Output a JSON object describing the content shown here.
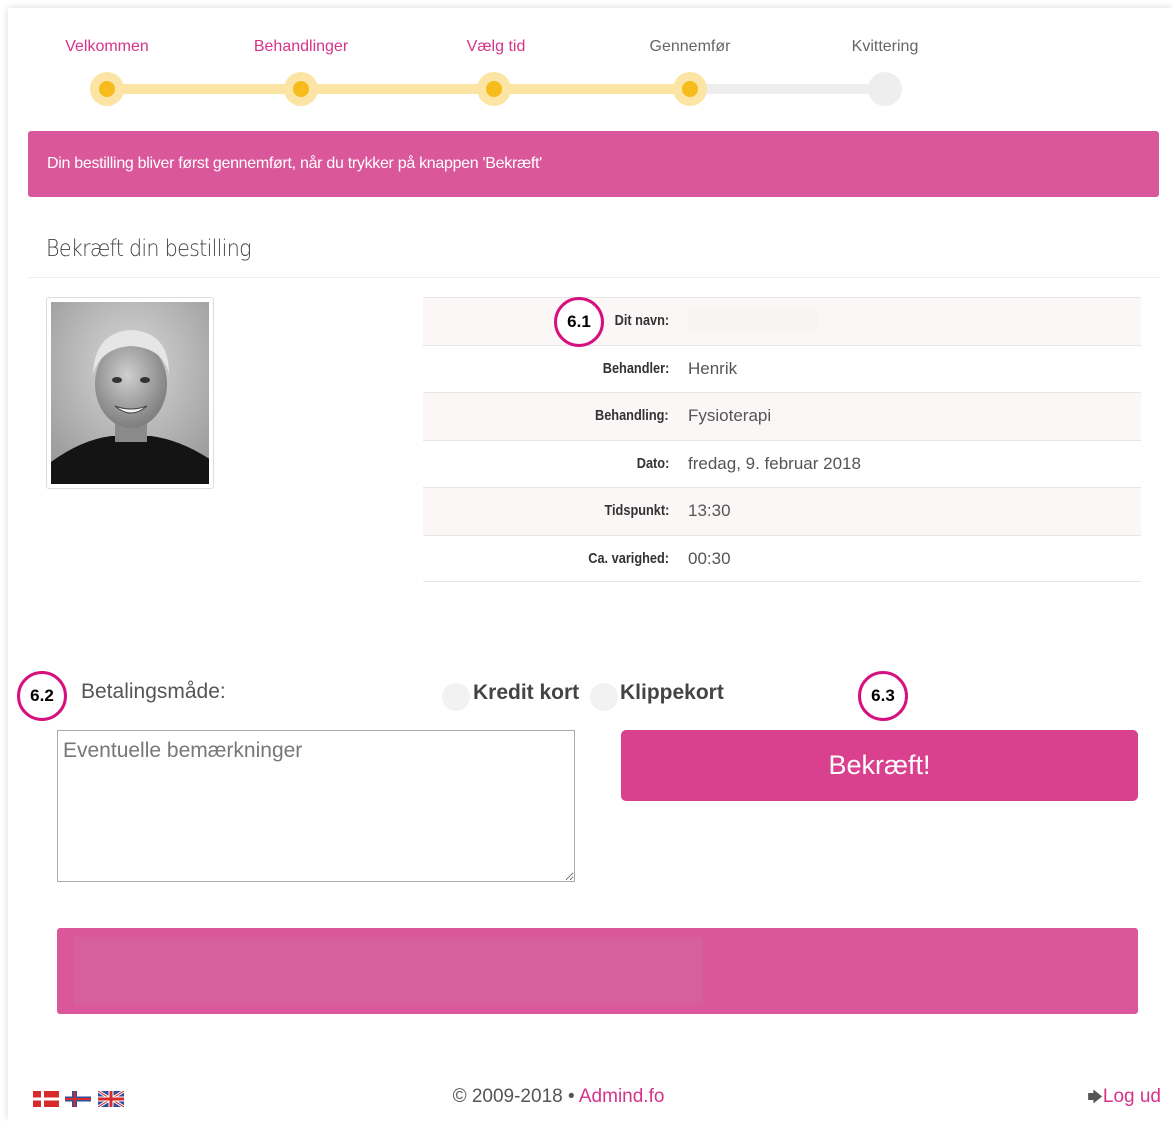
{
  "steps": [
    {
      "label": "Velkommen",
      "state": "done"
    },
    {
      "label": "Behandlinger",
      "state": "done"
    },
    {
      "label": "Vælg tid",
      "state": "done"
    },
    {
      "label": "Gennemfør",
      "state": "current"
    },
    {
      "label": "Kvittering",
      "state": "todo"
    }
  ],
  "alert": {
    "text": "Din bestilling bliver først gennemført, når du trykker på knappen 'Bekræft'"
  },
  "section": {
    "title": "Bekræft din bestilling"
  },
  "details": [
    {
      "label": "Dit navn:",
      "value": ""
    },
    {
      "label": "Behandler:",
      "value": "Henrik"
    },
    {
      "label": "Behandling:",
      "value": "Fysioterapi"
    },
    {
      "label": "Dato:",
      "value": "fredag, 9. februar 2018"
    },
    {
      "label": "Tidspunkt:",
      "value": "13:30"
    },
    {
      "label": "Ca. varighed:",
      "value": "00:30"
    }
  ],
  "badges": {
    "b1": "6.1",
    "b2": "6.2",
    "b3": "6.3"
  },
  "payment": {
    "label": "Betalingsmåde:",
    "options": [
      "Kredit kort",
      "Klippekort"
    ]
  },
  "notes": {
    "placeholder": "Eventuelle bemærkninger"
  },
  "confirm": {
    "label": "Bekræft!"
  },
  "footer": {
    "copyright": "© 2009-2018 • ",
    "link": "Admind.fo",
    "logout": "Log ud",
    "logout_icon": "sign-out-icon"
  },
  "flags": [
    "flag-denmark-icon",
    "flag-faroe-islands-icon",
    "flag-uk-icon"
  ],
  "colors": {
    "accent": "#d6338a",
    "alert_bg": "#d9579a",
    "button_bg": "#d9418f",
    "step_done": "#fbe4a4",
    "step_dot": "#f7bb1c",
    "badge_ring": "#d6107f"
  }
}
